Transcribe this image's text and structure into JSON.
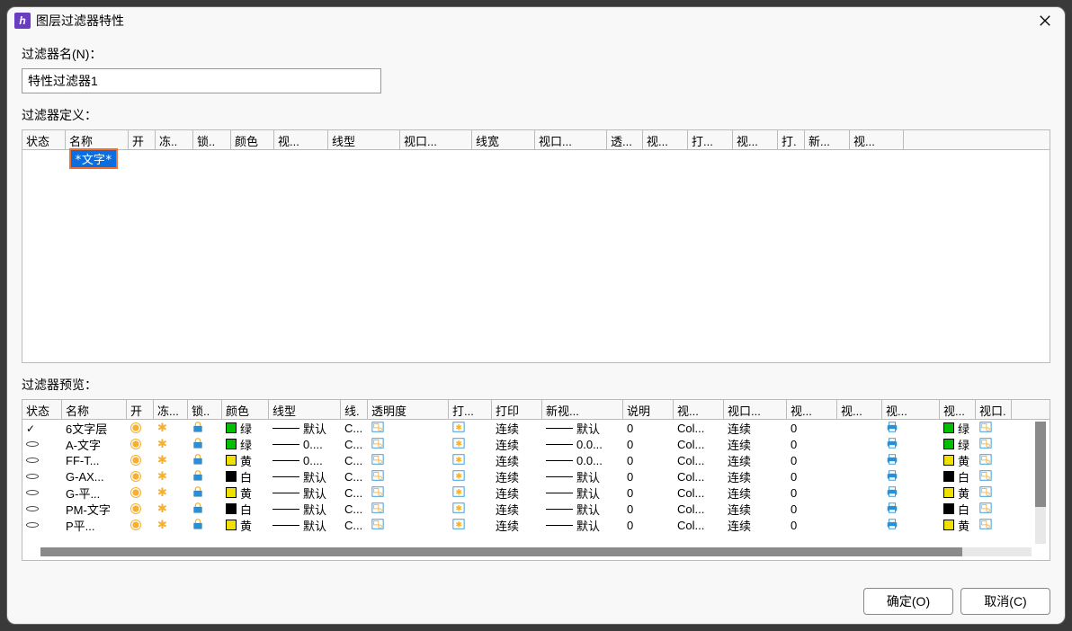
{
  "title": "图层过滤器特性",
  "filterNameLabel": "过滤器名(N)：",
  "filterNameValue": "特性过滤器1",
  "filterDefLabel": "过滤器定义：",
  "filterPrevLabel": "过滤器预览：",
  "defHeaders": [
    "状态",
    "名称",
    "开",
    "冻..",
    "锁..",
    "颜色",
    "视...",
    "线型",
    "视口...",
    "线宽",
    "视口...",
    "透...",
    "视...",
    "打...",
    "视...",
    "打.",
    "新...",
    "视..."
  ],
  "defWidths": [
    48,
    70,
    30,
    42,
    42,
    48,
    60,
    80,
    80,
    70,
    80,
    40,
    50,
    50,
    50,
    30,
    50,
    60
  ],
  "defRowName": "*文字*",
  "prevHeaders": [
    "状态",
    "名称",
    "开",
    "冻...",
    "锁..",
    "颜色",
    "线型",
    "线.",
    "透明度",
    "打...",
    "打印",
    "新视...",
    "说明",
    "视...",
    "视口...",
    "视...",
    "视...",
    "视...",
    "视...",
    "视口."
  ],
  "prevWidths": [
    44,
    72,
    30,
    38,
    38,
    52,
    80,
    30,
    90,
    48,
    56,
    90,
    56,
    56,
    70,
    56,
    50,
    64,
    40,
    40
  ],
  "previewRows": [
    {
      "status": "check",
      "name": "6文字层",
      "color": "#00c000",
      "colorName": "绿",
      "linetype": "默认",
      "vpPfx": "C...",
      "plot": "连续",
      "newvp": "默认",
      "trans": "0",
      "desc": "Col...",
      "vp1": "连续",
      "vp2": "0",
      "boxColor": "#00c000",
      "boxName": "绿"
    },
    {
      "status": "ell",
      "name": "A-文字",
      "color": "#00c000",
      "colorName": "绿",
      "linetype": "0....",
      "vpPfx": "C...",
      "plot": "连续",
      "newvp": "0.0...",
      "trans": "0",
      "desc": "Col...",
      "vp1": "连续",
      "vp2": "0",
      "boxColor": "#00c000",
      "boxName": "绿"
    },
    {
      "status": "ell",
      "name": "FF-T...",
      "color": "#f0e000",
      "colorName": "黄",
      "linetype": "0....",
      "vpPfx": "C...",
      "plot": "连续",
      "newvp": "0.0...",
      "trans": "0",
      "desc": "Col...",
      "vp1": "连续",
      "vp2": "0",
      "boxColor": "#f0e000",
      "boxName": "黄"
    },
    {
      "status": "ell",
      "name": "G-AX...",
      "color": "#000000",
      "colorName": "白",
      "linetype": "默认",
      "vpPfx": "C...",
      "plot": "连续",
      "newvp": "默认",
      "trans": "0",
      "desc": "Col...",
      "vp1": "连续",
      "vp2": "0",
      "boxColor": "#000000",
      "boxName": "白"
    },
    {
      "status": "ell",
      "name": "G-平...",
      "color": "#f0e000",
      "colorName": "黄",
      "linetype": "默认",
      "vpPfx": "C...",
      "plot": "连续",
      "newvp": "默认",
      "trans": "0",
      "desc": "Col...",
      "vp1": "连续",
      "vp2": "0",
      "boxColor": "#f0e000",
      "boxName": "黄"
    },
    {
      "status": "ell",
      "name": "PM-文字",
      "color": "#000000",
      "colorName": "白",
      "linetype": "默认",
      "vpPfx": "C...",
      "plot": "连续",
      "newvp": "默认",
      "trans": "0",
      "desc": "Col...",
      "vp1": "连续",
      "vp2": "0",
      "boxColor": "#000000",
      "boxName": "白"
    },
    {
      "status": "ell",
      "name": "P平...",
      "color": "#f0e000",
      "colorName": "黄",
      "linetype": "默认",
      "vpPfx": "C...",
      "plot": "连续",
      "newvp": "默认",
      "trans": "0",
      "desc": "Col...",
      "vp1": "连续",
      "vp2": "0",
      "boxColor": "#f0e000",
      "boxName": "黄"
    }
  ],
  "okLabel": "确定(O)",
  "cancelLabel": "取消(C)"
}
